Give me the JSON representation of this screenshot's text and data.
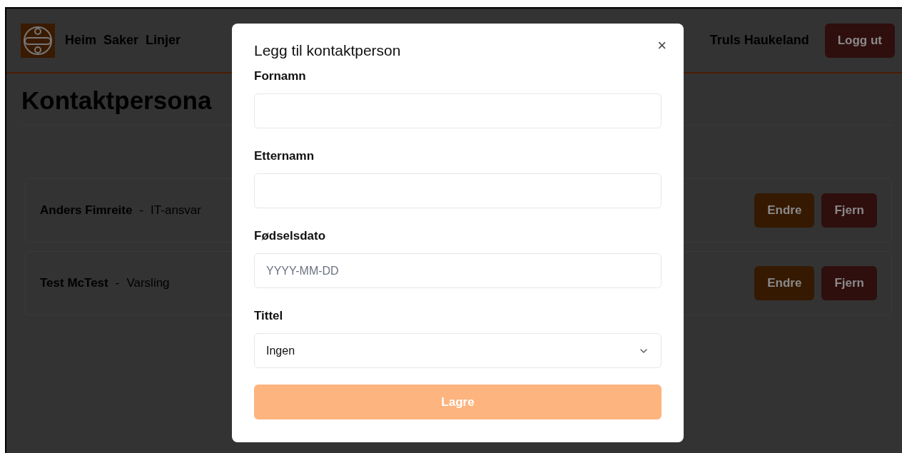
{
  "nav": {
    "links": [
      "Heim",
      "Saker",
      "Linjer"
    ],
    "user": "Truls Haukeland",
    "logout": "Logg ut"
  },
  "page": {
    "title": "Kontaktpersona"
  },
  "contacts": [
    {
      "name": "Anders Fimreite",
      "separator": "-",
      "role": "IT-ansvar",
      "edit": "Endre",
      "remove": "Fjern"
    },
    {
      "name": "Test McTest",
      "separator": "-",
      "role": "Varsling",
      "edit": "Endre",
      "remove": "Fjern"
    }
  ],
  "dialog": {
    "title": "Legg til kontaktperson",
    "close": "×",
    "fields": [
      {
        "kind": "text",
        "label": "Fornamn"
      },
      {
        "kind": "text",
        "label": "Etternamn"
      },
      {
        "kind": "text",
        "label": "Fødselsdato",
        "placeholder": "YYYY-MM-DD"
      },
      {
        "kind": "select",
        "label": "Tittel",
        "value": "Ingen"
      }
    ],
    "submit": {
      "label": "Lagre",
      "disabled": true
    }
  }
}
